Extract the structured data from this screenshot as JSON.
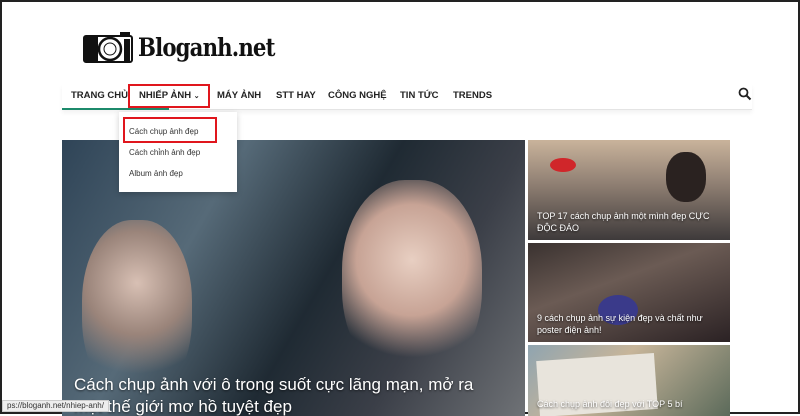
{
  "site": {
    "name": "Bloganh.net"
  },
  "nav": {
    "items": [
      "TRANG CHỦ",
      "NHIẾP ẢNH",
      "MÁY ẢNH",
      "STT HAY",
      "CÔNG NGHỆ",
      "TIN TỨC",
      "TRENDS"
    ]
  },
  "dropdown": {
    "items": [
      "Cách chụp ảnh đẹp",
      "Cách chỉnh ảnh đẹp",
      "Album ảnh đẹp"
    ]
  },
  "hero": {
    "title": "Cách chụp ảnh với ô trong suốt cực lãng mạn, mở ra một thế giới mơ hồ tuyệt đẹp"
  },
  "cards": [
    {
      "title": "TOP 17 cách chụp ảnh một mình đẹp CỰC ĐỘC ĐÁO"
    },
    {
      "title": "9 cách chụp ảnh sự kiện đẹp và chất như poster điện ảnh!"
    },
    {
      "title": "Cách chụp ảnh đôi đẹp với TOP 5 bí"
    }
  ],
  "status_url": "ps://bloganh.net/nhiep-anh/",
  "colors": {
    "accent": "#1c8a6b",
    "highlight": "#e0161d"
  }
}
